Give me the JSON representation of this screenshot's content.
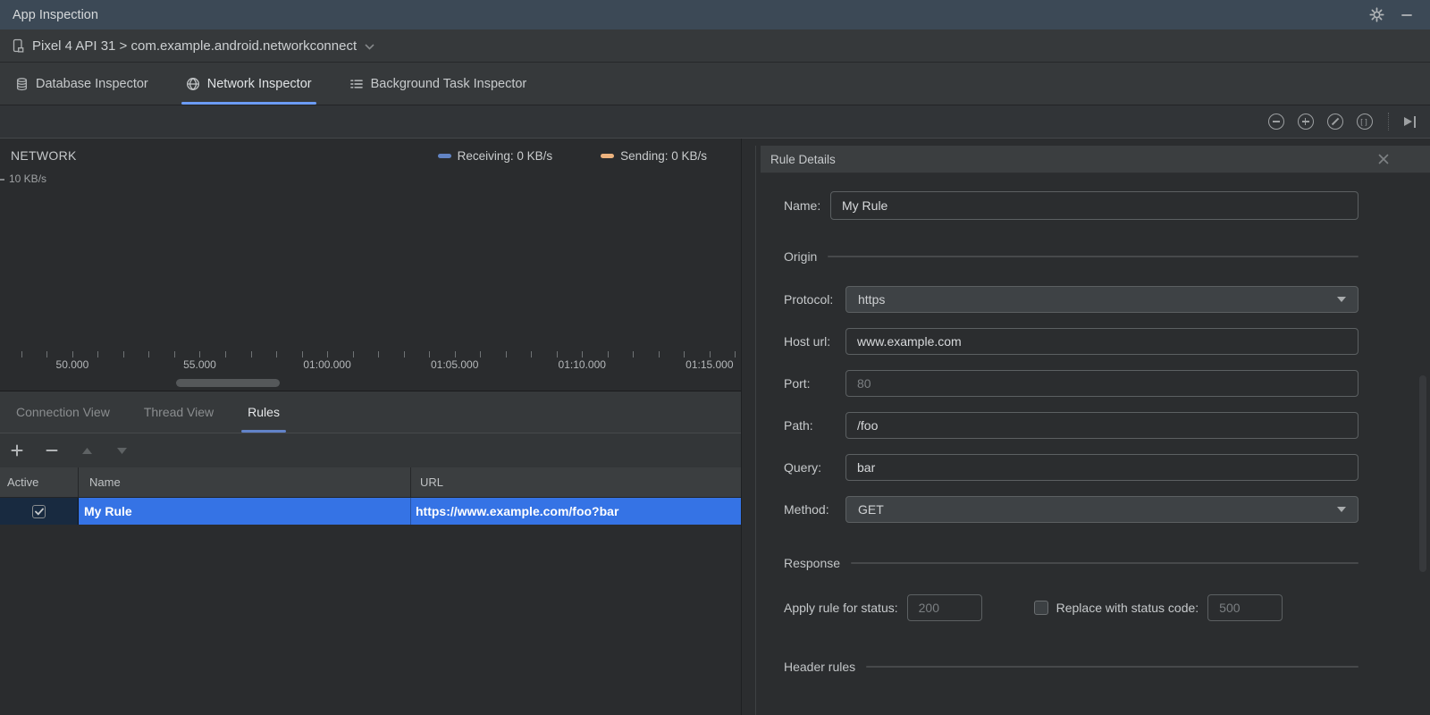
{
  "window": {
    "title": "App Inspection"
  },
  "device_bar": {
    "label": "Pixel 4 API 31 > com.example.android.networkconnect"
  },
  "inspector_tabs": [
    {
      "label": "Database Inspector",
      "icon": "database-icon",
      "selected": false
    },
    {
      "label": "Network Inspector",
      "icon": "globe-icon",
      "selected": true
    },
    {
      "label": "Background Task Inspector",
      "icon": "list-icon",
      "selected": false
    }
  ],
  "timeline_toolbar": {
    "icons": [
      "zoom-out-icon",
      "zoom-in-icon",
      "reset-zoom-icon",
      "zoom-to-selection-icon",
      "jump-to-live-icon"
    ]
  },
  "network_chart": {
    "title": "NETWORK",
    "y_axis_label": "10 KB/s",
    "legend": [
      {
        "label": "Receiving: 0 KB/s",
        "color": "#6284c4"
      },
      {
        "label": "Sending: 0 KB/s",
        "color": "#edb37e"
      }
    ],
    "x_ticks": [
      "50.000",
      "55.000",
      "01:00.000",
      "01:05.000",
      "01:10.000",
      "01:15.000"
    ],
    "chart_data": {
      "type": "line",
      "x": [
        "50.000",
        "55.000",
        "01:00.000",
        "01:05.000",
        "01:10.000",
        "01:15.000"
      ],
      "series": [
        {
          "name": "Receiving",
          "values": [
            0,
            0,
            0,
            0,
            0,
            0
          ]
        },
        {
          "name": "Sending",
          "values": [
            0,
            0,
            0,
            0,
            0,
            0
          ]
        }
      ],
      "ylabel": "KB/s",
      "ylim": [
        0,
        10
      ],
      "legend_position": "top-right",
      "grid": false
    }
  },
  "view_tabs": [
    {
      "label": "Connection View",
      "selected": false
    },
    {
      "label": "Thread View",
      "selected": false
    },
    {
      "label": "Rules",
      "selected": true
    }
  ],
  "rules_table": {
    "headers": [
      "Active",
      "Name",
      "URL"
    ],
    "rows": [
      {
        "active": true,
        "name": "My Rule",
        "url": "https://www.example.com/foo?bar",
        "selected": true
      }
    ]
  },
  "rule_details": {
    "title": "Rule Details",
    "name": {
      "label": "Name:",
      "value": "My Rule"
    },
    "origin": {
      "section": "Origin",
      "protocol": {
        "label": "Protocol:",
        "value": "https"
      },
      "host": {
        "label": "Host url:",
        "value": "www.example.com"
      },
      "port": {
        "label": "Port:",
        "placeholder": "80"
      },
      "path": {
        "label": "Path:",
        "value": "/foo"
      },
      "query": {
        "label": "Query:",
        "value": "bar"
      },
      "method": {
        "label": "Method:",
        "value": "GET"
      }
    },
    "response": {
      "section": "Response",
      "status_label": "Apply rule for status:",
      "status_placeholder": "200",
      "replace_checked": false,
      "replace_label": "Replace with status code:",
      "replace_placeholder": "500"
    },
    "header_rules": {
      "section": "Header rules"
    }
  },
  "colors": {
    "titlebar": "#3c4956",
    "selection_blue": "#3573e5",
    "tab_underline": "#6c9cf5",
    "legend_receiving": "#6284c4",
    "legend_sending": "#edb37e",
    "active_cell": "#182a40"
  }
}
